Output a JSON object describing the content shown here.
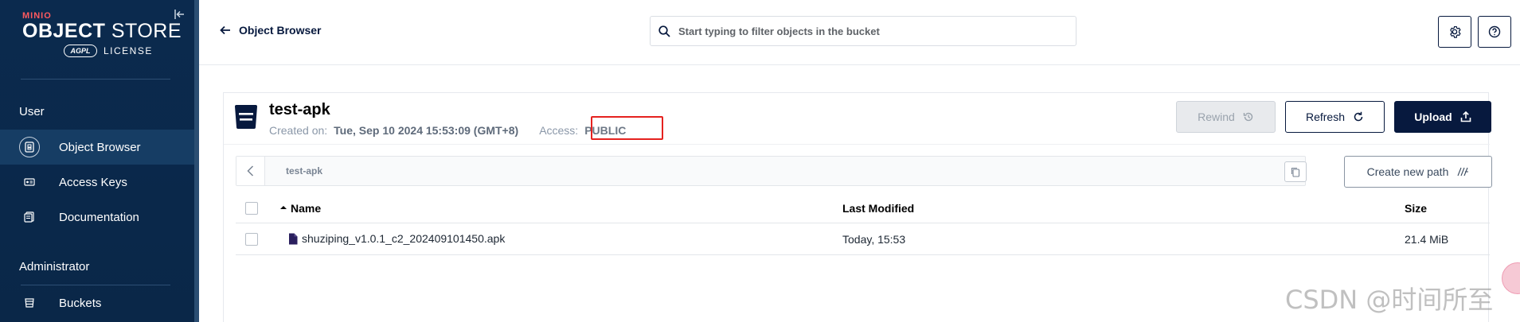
{
  "brand": {
    "minio": "MINIO",
    "product_bold": "OBJECT",
    "product_rest": " STORE",
    "agpl": "AGPL",
    "license": "LICENSE"
  },
  "sidebar": {
    "sections": [
      {
        "title": "User",
        "items": [
          {
            "label": "Object Browser",
            "icon": "object-browser-icon",
            "active": true
          },
          {
            "label": "Access Keys",
            "icon": "access-keys-icon",
            "active": false
          },
          {
            "label": "Documentation",
            "icon": "documentation-icon",
            "active": false
          }
        ]
      },
      {
        "title": "Administrator",
        "items": [
          {
            "label": "Buckets",
            "icon": "buckets-icon",
            "active": false
          }
        ]
      }
    ]
  },
  "header": {
    "back_label": "Object Browser",
    "search_placeholder": "Start typing to filter objects in the bucket"
  },
  "bucket": {
    "name": "test-apk",
    "created_label": "Created on:",
    "created_value": "Tue, Sep 10 2024 15:53:09 (GMT+8)",
    "access_label": "Access:",
    "access_value": "PUBLIC"
  },
  "actions": {
    "rewind": "Rewind",
    "refresh": "Refresh",
    "upload": "Upload",
    "create_path": "Create new path"
  },
  "path": {
    "current": "test-apk"
  },
  "table": {
    "columns": {
      "name": "Name",
      "modified": "Last Modified",
      "size": "Size"
    },
    "rows": [
      {
        "name": "shuziping_v1.0.1_c2_202409101450.apk",
        "modified": "Today, 15:53",
        "size": "21.4 MiB"
      }
    ]
  },
  "watermark": "CSDN @时间所至",
  "colors": {
    "sidebar_bg": "#0b2a4e",
    "primary": "#07193e",
    "highlight_border": "#e5221f",
    "brand_red": "#ff5a5f"
  }
}
